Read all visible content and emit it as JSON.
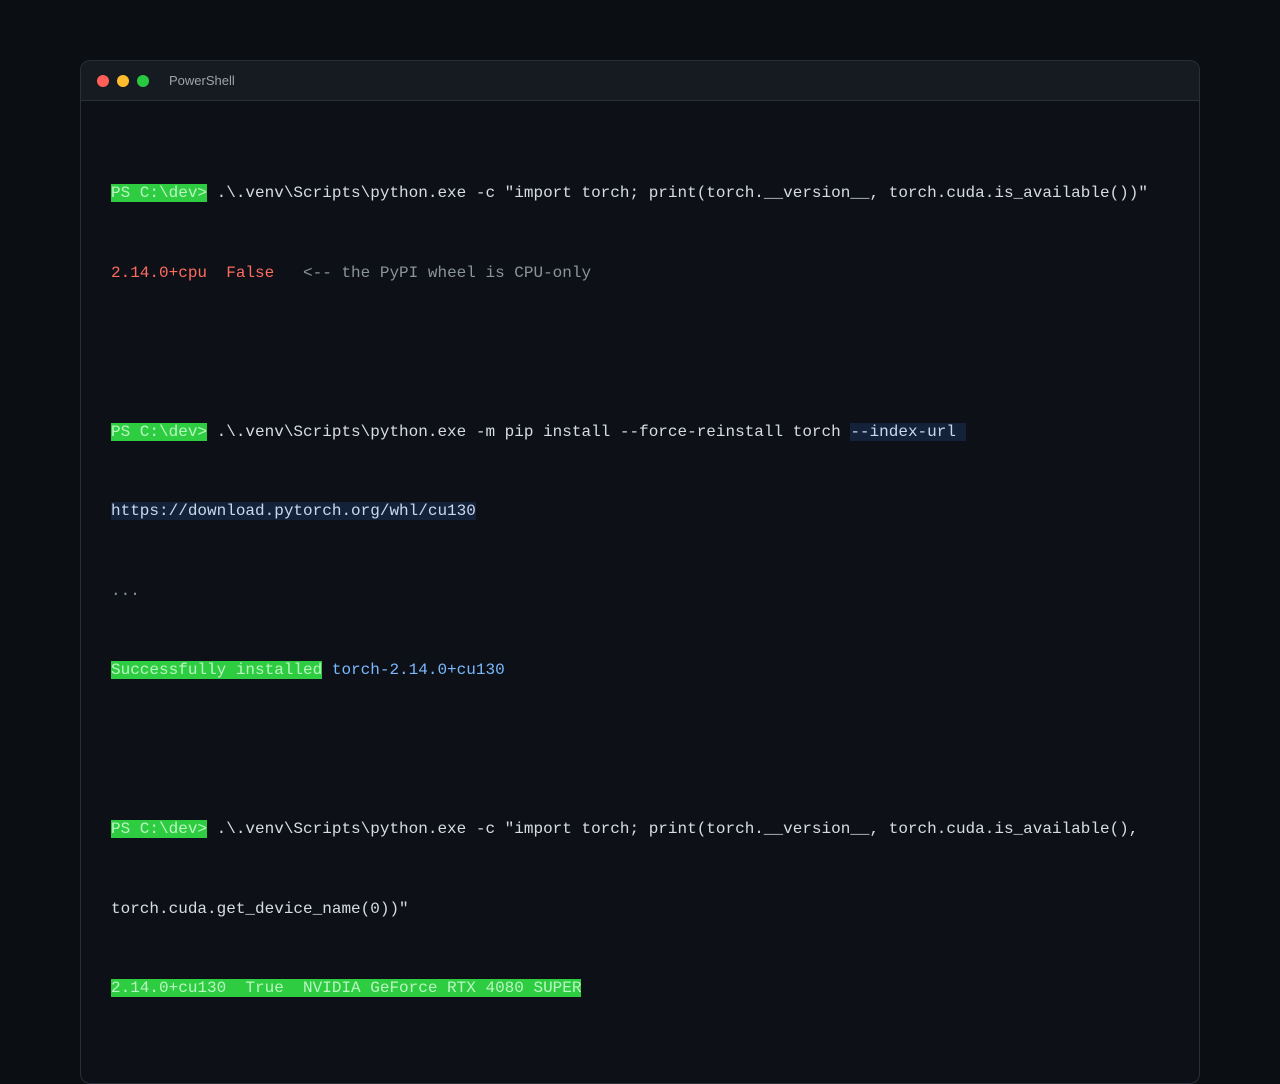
{
  "window": {
    "title": "PowerShell"
  },
  "terminal": {
    "prompt": "PS C:\\dev>",
    "cmd1": " .\\.venv\\Scripts\\python.exe -c \"import torch; print(torch.__version__, torch.cuda.is_available())\"",
    "out1_version": "2.14.0+cpu",
    "out1_sep": "  ",
    "out1_bool": "False",
    "out1_comment": "   <-- the PyPI wheel is CPU-only",
    "cmd2": " .\\.venv\\Scripts\\python.exe -m pip install --force-reinstall torch ",
    "cmd2_flag": "--index-url ",
    "cmd2_url": "https://download.pytorch.org/whl/cu130",
    "ellipsis": "...",
    "success_label": "Successfully installed",
    "success_pkg": " torch-2.14.0+cu130",
    "cmd3_line1": " .\\.venv\\Scripts\\python.exe -c \"import torch; print(torch.__version__, torch.cuda.is_available(),",
    "cmd3_line2": "torch.cuda.get_device_name(0))\"",
    "out3": "2.14.0+cu130  True  NVIDIA GeForce RTX 4080 SUPER"
  },
  "colors": {
    "close": "#ff5f57",
    "minimize": "#febc2e",
    "maximize": "#28c840",
    "prompt_bg": "#2ecc40",
    "error": "#ff6b5f",
    "package": "#79b8ff"
  }
}
